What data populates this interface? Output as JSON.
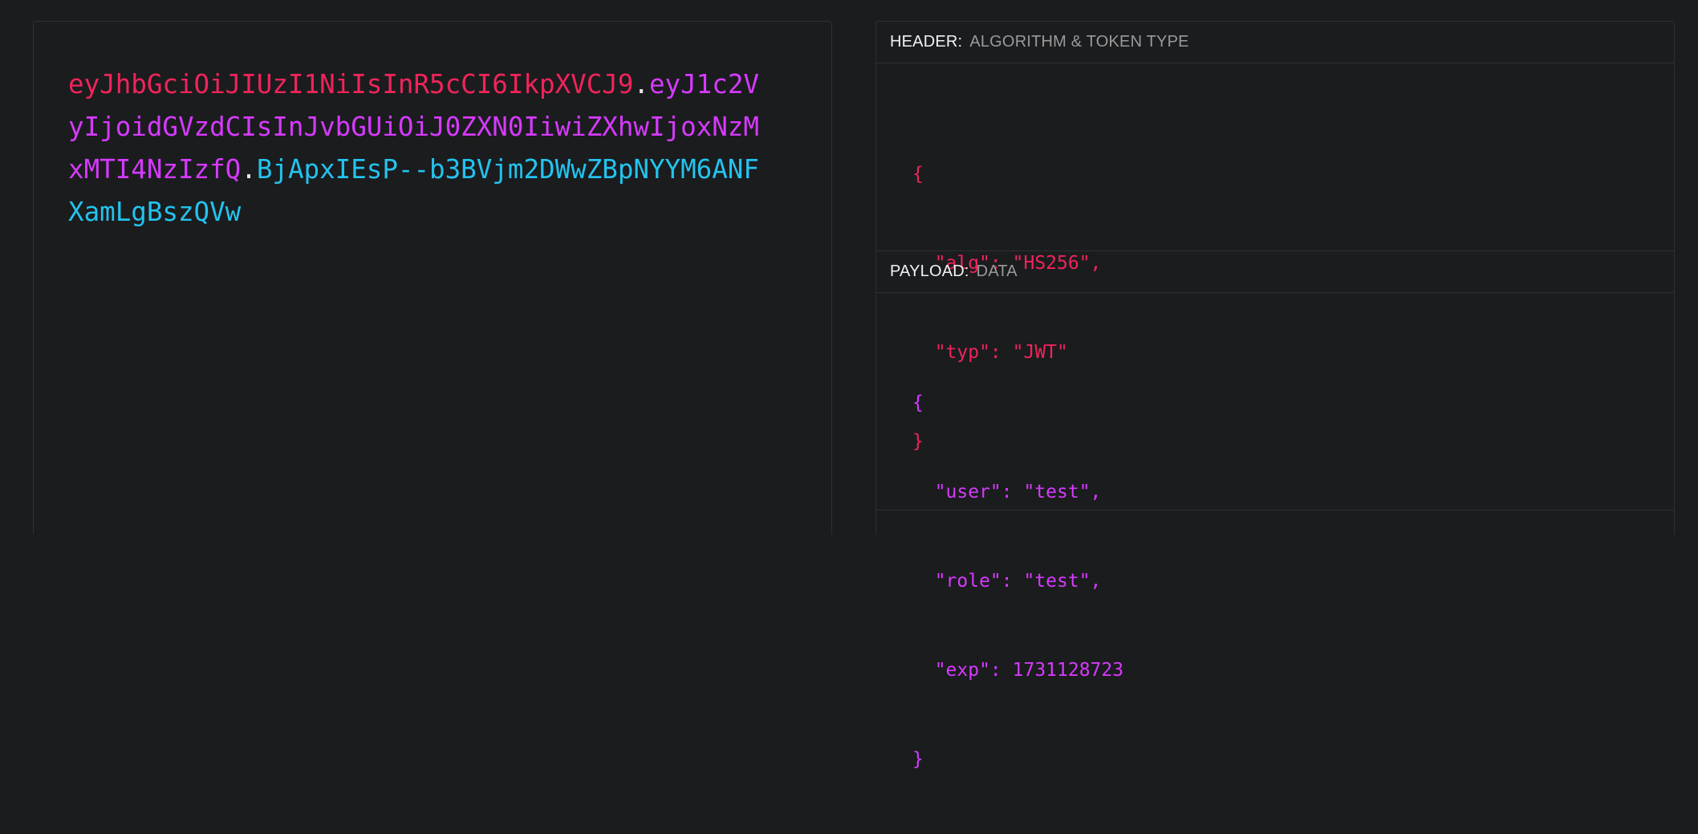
{
  "encoded": {
    "header": "eyJhbGciOiJIUzI1NiIsInR5cCI6IkpXVCJ9",
    "payload": "eyJ1c2VyIjoidGVzdCIsInJvbGUiOiJ0ZXN0IiwiZXhwIjoxNzMxMTI4NzIzfQ",
    "signature": "BjApxIEsP--b3BVjm2DWwZBpNYYM6ANFXamLgBszQVw",
    "dot": "."
  },
  "header_section": {
    "title": "HEADER:",
    "subtitle": "ALGORITHM & TOKEN TYPE",
    "lines": [
      "{",
      "  \"alg\": \"HS256\",",
      "  \"typ\": \"JWT\"",
      "}"
    ]
  },
  "payload_section": {
    "title": "PAYLOAD:",
    "subtitle": "DATA",
    "lines": [
      "{",
      "  \"user\": \"test\",",
      "  \"role\": \"test\",",
      "  \"exp\": 1731128723",
      "}"
    ]
  },
  "colors": {
    "header": "#f0245b",
    "payload": "#d63aff",
    "signature": "#23c3ee",
    "background": "#1b1c1e"
  }
}
